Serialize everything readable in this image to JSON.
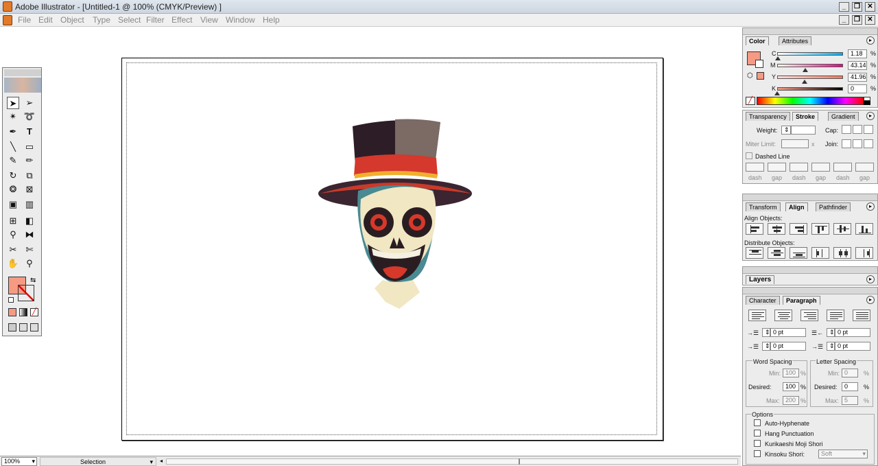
{
  "window": {
    "title": "Adobe Illustrator - [Untitled-1 @ 100% (CMYK/Preview) ]"
  },
  "menu": [
    "File",
    "Edit",
    "Object",
    "Type",
    "Select",
    "Filter",
    "Effect",
    "View",
    "Window",
    "Help"
  ],
  "color_panel": {
    "tabs": [
      "Color",
      "Attributes"
    ],
    "channels": [
      {
        "label": "C",
        "value": "1.18",
        "pct": "%",
        "level": 0.0118
      },
      {
        "label": "M",
        "value": "43.14",
        "pct": "%",
        "level": 0.4314
      },
      {
        "label": "Y",
        "value": "41.96",
        "pct": "%",
        "level": 0.4196
      },
      {
        "label": "K",
        "value": "0",
        "pct": "%",
        "level": 0
      }
    ],
    "fill_color": "#f79a83"
  },
  "stroke_panel": {
    "tabs": [
      "Transparency",
      "Stroke",
      "Gradient"
    ],
    "weight_label": "Weight:",
    "cap_label": "Cap:",
    "miter_label": "Miter Limit:",
    "miter_unit": "x",
    "join_label": "Join:",
    "dashed_label": "Dashed Line",
    "dash_labels": [
      "dash",
      "gap",
      "dash",
      "gap",
      "dash",
      "gap"
    ]
  },
  "align_panel": {
    "tabs": [
      "Transform",
      "Align",
      "Pathfinder"
    ],
    "align_label": "Align Objects:",
    "distribute_label": "Distribute Objects:"
  },
  "layers_panel": {
    "tabs": [
      "Layers"
    ]
  },
  "paragraph_panel": {
    "tabs": [
      "Character",
      "Paragraph"
    ],
    "indent_values": [
      "0 pt",
      "0 pt",
      "0 pt",
      "0 pt"
    ],
    "word_spacing": {
      "title": "Word Spacing",
      "min_label": "Min:",
      "min": "100",
      "desired_label": "Desired:",
      "desired": "100",
      "max_label": "Max:",
      "max": "200",
      "pct": "%"
    },
    "letter_spacing": {
      "title": "Letter Spacing",
      "min_label": "Min:",
      "min": "0",
      "desired_label": "Desired:",
      "desired": "0",
      "max_label": "Max:",
      "max": "5",
      "pct": "%"
    },
    "options_title": "Options",
    "options": [
      "Auto-Hyphenate",
      "Hang Punctuation",
      "Kurikaeshi Moji Shori",
      "Kinsoku Shori:"
    ],
    "kinsoku_value": "Soft"
  },
  "status": {
    "zoom": "100%",
    "tool": "Selection"
  }
}
